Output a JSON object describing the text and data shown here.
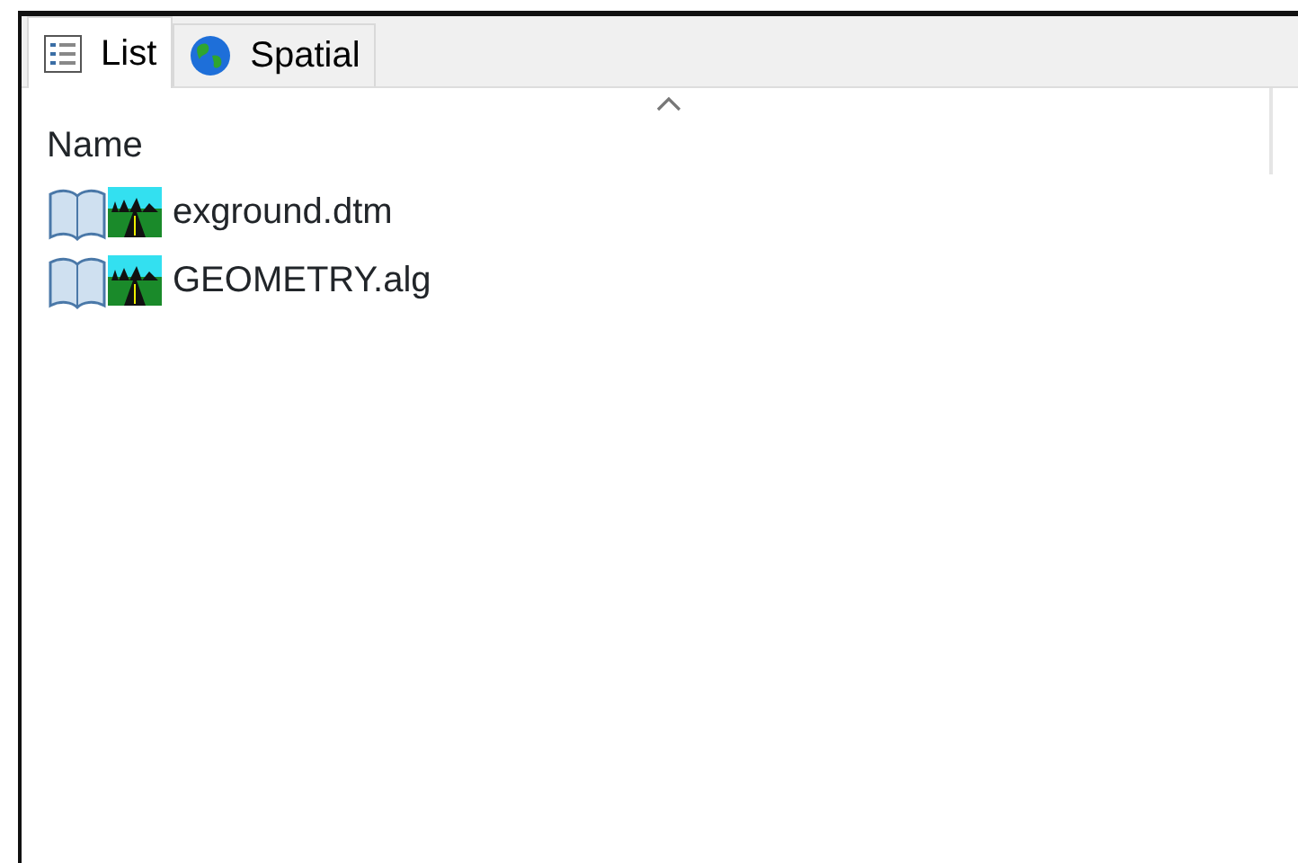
{
  "tabs": [
    {
      "label": "List",
      "kind": "list",
      "selected": true
    },
    {
      "label": "Spatial",
      "kind": "globe",
      "selected": false
    }
  ],
  "columns": [
    {
      "label": "Name",
      "sorted": true
    }
  ],
  "files": [
    {
      "name": "exground.dtm"
    },
    {
      "name": "GEOMETRY.alg"
    }
  ]
}
